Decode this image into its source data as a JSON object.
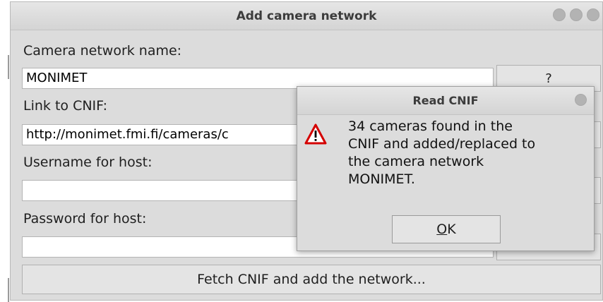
{
  "main_window": {
    "title": "Add camera network",
    "fields": [
      {
        "label": "Camera network name:",
        "value": "MONIMET"
      },
      {
        "label": "Link to CNIF:",
        "value": "http://monimet.fmi.fi/cameras/c"
      },
      {
        "label": "Username for host:",
        "value": ""
      },
      {
        "label": "Password for host:",
        "value": ""
      }
    ],
    "help_button": "?",
    "fetch_button": "Fetch CNIF and add the network..."
  },
  "dialog": {
    "title": "Read CNIF",
    "message_lines": [
      "34 cameras found in the",
      "CNIF and added/replaced to",
      "the camera network",
      "MONIMET."
    ],
    "ok_mnemonic": "O",
    "ok_rest": "K",
    "icon": "warning-icon"
  },
  "colors": {
    "window_bg": "#dcdcdc",
    "warning_red": "#d40000"
  }
}
